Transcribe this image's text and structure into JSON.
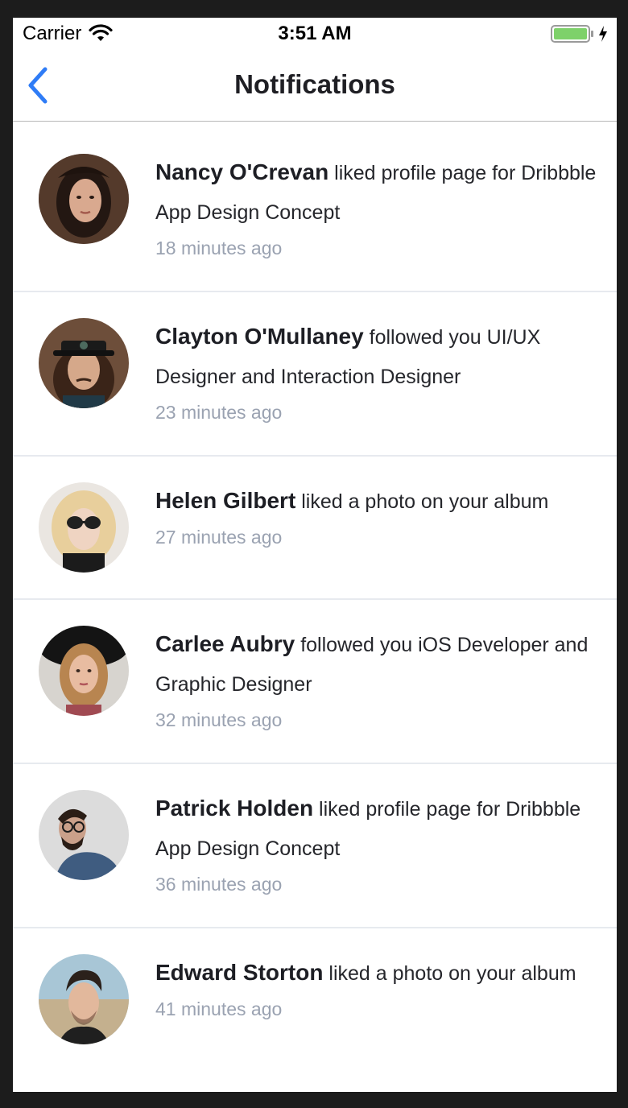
{
  "status_bar": {
    "carrier": "Carrier",
    "time": "3:51 AM",
    "battery_color": "#7ed16a"
  },
  "nav": {
    "title": "Notifications",
    "back_icon": "chevron-left-icon",
    "accent_color": "#2f7cf6"
  },
  "notifications": [
    {
      "name": "Nancy O'Crevan",
      "action": "liked profile page for Dribbble App Design Concept",
      "time": "18 minutes ago",
      "avatar": "avatar-nancy"
    },
    {
      "name": "Clayton O'Mullaney",
      "action": "followed you UI/UX Designer and Interaction Designer",
      "time": "23 minutes ago",
      "avatar": "avatar-clayton"
    },
    {
      "name": "Helen Gilbert",
      "action": "liked a photo on your album",
      "time": "27 minutes ago",
      "avatar": "avatar-helen"
    },
    {
      "name": "Carlee Aubry",
      "action": "followed you iOS Developer and Graphic Designer",
      "time": "32 minutes ago",
      "avatar": "avatar-carlee"
    },
    {
      "name": "Patrick Holden",
      "action": "liked profile page for Dribbble App Design Concept",
      "time": "36 minutes ago",
      "avatar": "avatar-patrick"
    },
    {
      "name": "Edward Storton",
      "action": "liked a photo on your album",
      "time": "41 minutes ago",
      "avatar": "avatar-edward"
    }
  ]
}
